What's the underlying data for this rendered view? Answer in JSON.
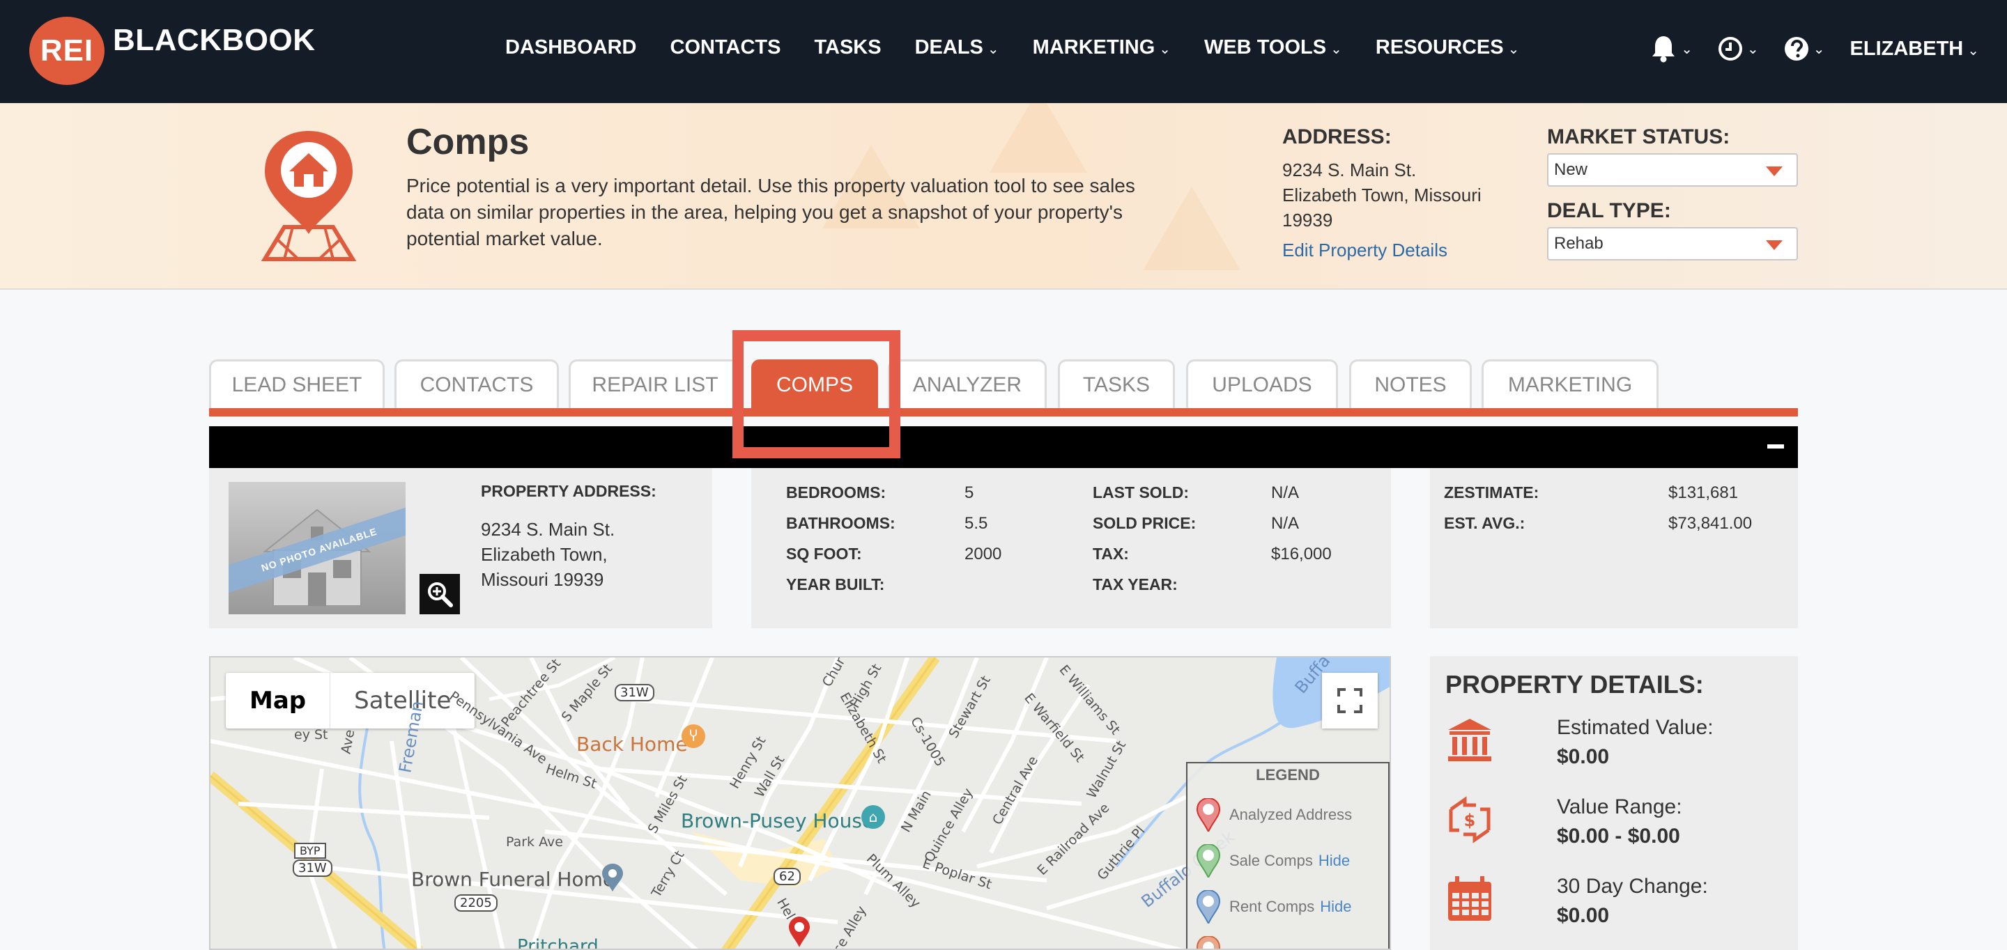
{
  "nav": {
    "logo_badge": "REI",
    "logo_text": "BLACKBOOK",
    "items": [
      {
        "label": "DASHBOARD",
        "dropdown": false
      },
      {
        "label": "CONTACTS",
        "dropdown": false
      },
      {
        "label": "TASKS",
        "dropdown": false
      },
      {
        "label": "DEALS",
        "dropdown": true
      },
      {
        "label": "MARKETING",
        "dropdown": true
      },
      {
        "label": "WEB TOOLS",
        "dropdown": true
      },
      {
        "label": "RESOURCES",
        "dropdown": true
      }
    ],
    "icons": [
      "bell-icon",
      "clock-icon",
      "help-icon"
    ],
    "user": "ELIZABETH",
    "caret": "⌄"
  },
  "header": {
    "title": "Comps",
    "description": "Price potential is a very important detail. Use this property valuation tool to see sales data on similar properties in the area, helping you get a snapshot of your property's potential market value.",
    "address_label": "ADDRESS:",
    "address_lines": [
      "9234 S. Main St.",
      "Elizabeth Town, Missouri",
      "19939"
    ],
    "edit_link": "Edit Property Details",
    "market_status_label": "MARKET STATUS:",
    "market_status_value": "New",
    "deal_type_label": "DEAL TYPE:",
    "deal_type_value": "Rehab"
  },
  "tabs": [
    {
      "label": "LEAD SHEET",
      "active": false
    },
    {
      "label": "CONTACTS",
      "active": false
    },
    {
      "label": "REPAIR LIST",
      "active": false
    },
    {
      "label": "COMPS",
      "active": true
    },
    {
      "label": "ANALYZER",
      "active": false
    },
    {
      "label": "TASKS",
      "active": false
    },
    {
      "label": "UPLOADS",
      "active": false
    },
    {
      "label": "NOTES",
      "active": false
    },
    {
      "label": "MARKETING",
      "active": false
    }
  ],
  "property": {
    "photo_placeholder": "NO PHOTO AVAILABLE",
    "address_label": "PROPERTY ADDRESS:",
    "address_lines": [
      "9234 S. Main St.",
      "Elizabeth Town,",
      "Missouri 19939"
    ]
  },
  "stats": {
    "left": [
      {
        "label": "BEDROOMS:",
        "value": "5"
      },
      {
        "label": "BATHROOMS:",
        "value": "5.5"
      },
      {
        "label": "SQ FOOT:",
        "value": "2000"
      },
      {
        "label": "YEAR BUILT:",
        "value": ""
      }
    ],
    "right": [
      {
        "label": "LAST SOLD:",
        "value": "N/A"
      },
      {
        "label": "SOLD PRICE:",
        "value": "N/A"
      },
      {
        "label": "TAX:",
        "value": "$16,000"
      },
      {
        "label": "TAX YEAR:",
        "value": ""
      }
    ]
  },
  "valuation": [
    {
      "label": "ZESTIMATE:",
      "value": "$131,681"
    },
    {
      "label": "EST. AVG.:",
      "value": "$73,841.00"
    }
  ],
  "map": {
    "type_map": "Map",
    "type_satellite": "Satellite",
    "legend_title": "LEGEND",
    "legend_items": [
      {
        "label": "Analyzed Address",
        "hide": ""
      },
      {
        "label": "Sale Comps",
        "hide": "Hide"
      },
      {
        "label": "Rent Comps",
        "hide": "Hide"
      }
    ],
    "places": {
      "back_home": "Back Home",
      "brown_pusey": "Brown-Pusey House",
      "brown_funeral": "Brown Funeral Home",
      "pritchard": "Pritchard"
    },
    "streets": {
      "freeman": "Freeman",
      "buffalo_creek": "Buffalo Creek",
      "buffalo_top": "Buffa",
      "park_ave": "Park Ave",
      "helm_st": "Helm St",
      "maple_st": "S Maple St",
      "peachtree": "Peachtree St",
      "penn_ave": "Pennsylvania Ave",
      "miles_st": "S Miles St",
      "henry_st": "Henry St",
      "wall_st": "Wall St",
      "elizabeth_st": "Elizabeth St",
      "high_st": "High St",
      "cs1005": "Cs-1005",
      "stewart_st": "Stewart St",
      "n_main": "N Main",
      "quince": "Quince Alley",
      "central": "Central Ave",
      "warfield": "E Warfield St",
      "williams": "E Williams St",
      "walnut": "Walnut St",
      "railroad": "E Railroad Ave",
      "guthrie": "Guthrie Pl",
      "poplar": "E Poplar St",
      "plum": "Plum Alley",
      "terry": "Terry Ct",
      "chur": "Chur",
      "ave": "Ave",
      "ey_st": "ey St",
      "hel": "Hel",
      "ce_alley": "ce Alley",
      "shield_31w": "31W",
      "shield_byp": "BYP",
      "shield_31w_b": "31W",
      "shield_2205": "2205",
      "shield_62": "62"
    }
  },
  "details": {
    "title": "PROPERTY DETAILS:",
    "rows": [
      {
        "label": "Estimated Value:",
        "value": "$0.00",
        "icon": "bank-icon"
      },
      {
        "label": "Value Range:",
        "value": "$0.00 - $0.00",
        "icon": "value-range-icon"
      },
      {
        "label": "30 Day Change:",
        "value": "$0.00",
        "icon": "calendar-icon"
      }
    ]
  },
  "colors": {
    "accent": "#e05a3c",
    "nav_bg": "#141c27",
    "link": "#2b6aa8",
    "highlight": "#e65c4a"
  }
}
